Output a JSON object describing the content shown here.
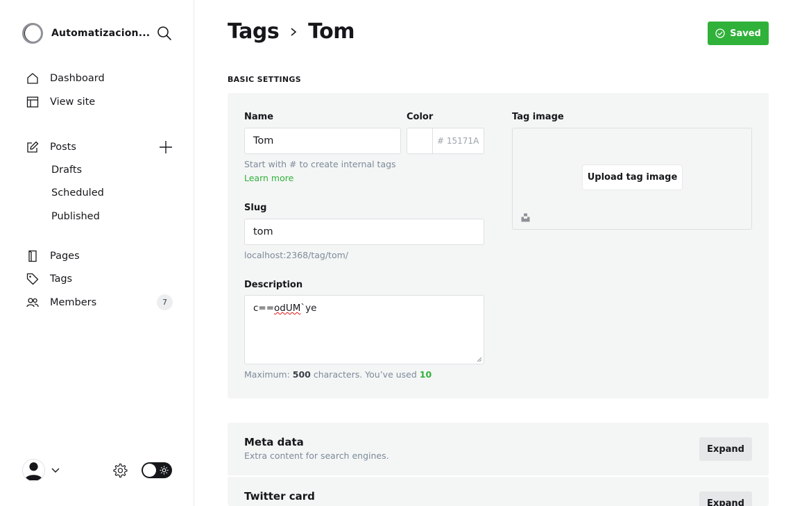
{
  "sidebar": {
    "site_title": "Automatizacion...",
    "nav": {
      "dashboard": "Dashboard",
      "view_site": "View site",
      "posts": "Posts",
      "drafts": "Drafts",
      "scheduled": "Scheduled",
      "published": "Published",
      "pages": "Pages",
      "tags": "Tags",
      "members": "Members",
      "members_count": "7"
    }
  },
  "header": {
    "breadcrumb_parent": "Tags",
    "breadcrumb_current": "Tom",
    "saved_label": "Saved"
  },
  "basic_settings": {
    "section_title": "BASIC SETTINGS",
    "name": {
      "label": "Name",
      "value": "Tom",
      "hint": "Start with # to create internal tags",
      "learn_more": "Learn more"
    },
    "color": {
      "label": "Color",
      "hash": "#",
      "placeholder": "15171A"
    },
    "tag_image": {
      "label": "Tag image",
      "upload_label": "Upload tag image"
    },
    "slug": {
      "label": "Slug",
      "value": "tom",
      "url": "localhost:2368/tag/tom/"
    },
    "description": {
      "label": "Description",
      "value_pre": "c==",
      "value_misspelled": "odUM",
      "value_post": "`ye",
      "limit_prefix": "Maximum: ",
      "limit_max": "500",
      "limit_mid": " characters. You’ve used ",
      "limit_used": "10"
    }
  },
  "meta_data": {
    "title": "Meta data",
    "subtitle": "Extra content for search engines.",
    "expand_label": "Expand"
  },
  "twitter_card": {
    "title": "Twitter card",
    "expand_label": "Expand"
  },
  "colors": {
    "accent": "#30b13a",
    "text": "#15171a",
    "muted": "#7c8b9a",
    "card_bg": "#f4f5f5"
  }
}
